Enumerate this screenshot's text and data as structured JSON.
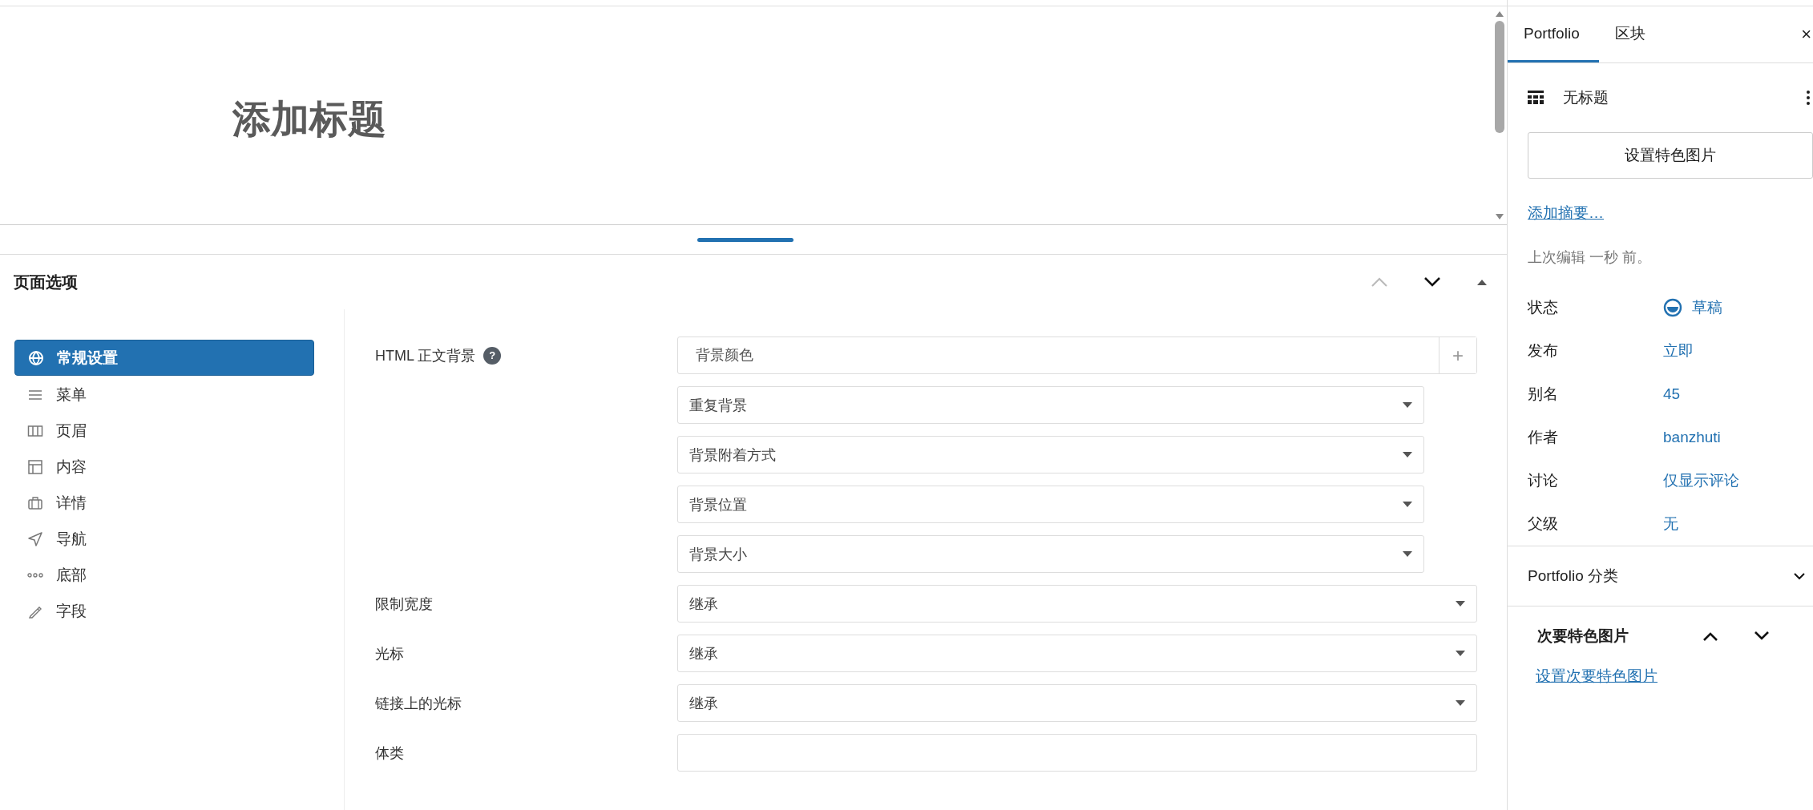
{
  "editor": {
    "title_placeholder": "添加标题"
  },
  "page_options": {
    "title": "页面选项",
    "nav": [
      {
        "label": "常规设置",
        "selected": true
      },
      {
        "label": "菜单",
        "selected": false
      },
      {
        "label": "页眉",
        "selected": false
      },
      {
        "label": "内容",
        "selected": false
      },
      {
        "label": "详情",
        "selected": false
      },
      {
        "label": "导航",
        "selected": false
      },
      {
        "label": "底部",
        "selected": false
      },
      {
        "label": "字段",
        "selected": false
      }
    ],
    "fields": [
      {
        "label": "HTML 正文背景",
        "help": "?",
        "controls": [
          {
            "kind": "color",
            "placeholder": "背景颜色",
            "button": "+"
          },
          {
            "kind": "select",
            "value": "重复背景"
          },
          {
            "kind": "select",
            "value": "背景附着方式"
          },
          {
            "kind": "select",
            "value": "背景位置"
          },
          {
            "kind": "select",
            "value": "背景大小"
          }
        ]
      },
      {
        "label": "限制宽度",
        "controls": [
          {
            "kind": "select",
            "value": "继承"
          }
        ]
      },
      {
        "label": "光标",
        "controls": [
          {
            "kind": "select",
            "value": "继承"
          }
        ]
      },
      {
        "label": "链接上的光标",
        "controls": [
          {
            "kind": "select",
            "value": "继承"
          }
        ]
      },
      {
        "label": "体类",
        "controls": [
          {
            "kind": "text"
          }
        ]
      }
    ]
  },
  "sidebar": {
    "tabs": [
      {
        "label": "Portfolio",
        "selected": true
      },
      {
        "label": "区块",
        "selected": false
      }
    ],
    "close": "×",
    "post": {
      "title": "无标题"
    },
    "featured_button": "设置特色图片",
    "excerpt_link": "添加摘要…",
    "last_edited": "上次编辑 一秒 前。",
    "meta": [
      {
        "label": "状态",
        "value": "草稿",
        "kind": "status"
      },
      {
        "label": "发布",
        "value": "立即",
        "kind": "link"
      },
      {
        "label": "别名",
        "value": "45",
        "kind": "link"
      },
      {
        "label": "作者",
        "value": "banzhuti",
        "kind": "link"
      },
      {
        "label": "讨论",
        "value": "仅显示评论",
        "kind": "link"
      },
      {
        "label": "父级",
        "value": "无",
        "kind": "link"
      }
    ],
    "panels": [
      {
        "title": "Portfolio 分类",
        "expanded": false
      },
      {
        "title": "次要特色图片",
        "expanded": true,
        "link": "设置次要特色图片"
      }
    ]
  }
}
